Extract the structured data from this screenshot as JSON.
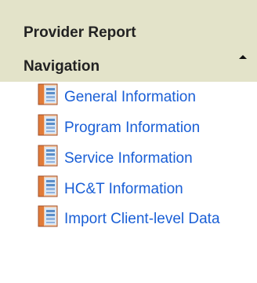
{
  "header": {
    "title": "Provider Report\nNavigation",
    "toggle_icon": "triangle-up-icon"
  },
  "nav": {
    "icon": "report-document-icon",
    "items": [
      {
        "label": "General Information"
      },
      {
        "label": "Program Information"
      },
      {
        "label": "Service Information"
      },
      {
        "label": "HC&T Information"
      },
      {
        "label": "Import Client-level Data"
      }
    ]
  },
  "colors": {
    "header_bg": "#e3e3c9",
    "link": "#1a5fd6",
    "icon_orange": "#e07b39",
    "icon_blue": "#5b8ec9"
  }
}
